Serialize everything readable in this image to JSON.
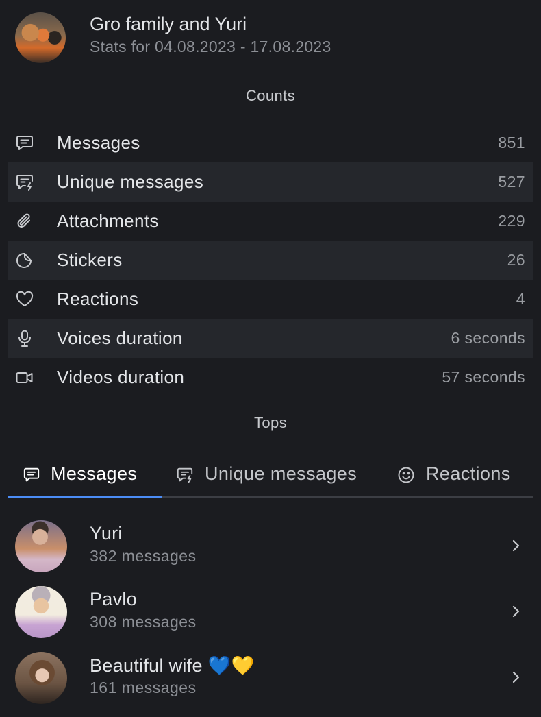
{
  "header": {
    "title": "Gro family and Yuri",
    "subtitle": "Stats for 04.08.2023 - 17.08.2023",
    "avatar_icon": "group-photo-avatar"
  },
  "counts": {
    "section_label": "Counts",
    "rows": [
      {
        "icon": "message-icon",
        "label": "Messages",
        "value": "851"
      },
      {
        "icon": "unique-message-icon",
        "label": "Unique messages",
        "value": "527"
      },
      {
        "icon": "paperclip-icon",
        "label": "Attachments",
        "value": "229"
      },
      {
        "icon": "sticker-icon",
        "label": "Stickers",
        "value": "26"
      },
      {
        "icon": "heart-icon",
        "label": "Reactions",
        "value": "4"
      },
      {
        "icon": "microphone-icon",
        "label": "Voices duration",
        "value": "6 seconds"
      },
      {
        "icon": "video-camera-icon",
        "label": "Videos duration",
        "value": "57 seconds"
      }
    ]
  },
  "tops": {
    "section_label": "Tops",
    "tabs": [
      {
        "icon": "message-icon",
        "label": "Messages",
        "active": true
      },
      {
        "icon": "unique-message-icon",
        "label": "Unique messages",
        "active": false
      },
      {
        "icon": "smile-icon",
        "label": "Reactions",
        "active": false
      }
    ],
    "items": [
      {
        "name": "Yuri",
        "count": "382 messages"
      },
      {
        "name": "Pavlo",
        "count": "308 messages"
      },
      {
        "name": "Beautiful wife 💙💛",
        "count": "161 messages"
      }
    ]
  },
  "colors": {
    "background": "#1b1c20",
    "row_shade": "#25272c",
    "accent": "#4c8df6",
    "text_primary": "#e3e5e8",
    "text_secondary": "#8c8f95"
  }
}
